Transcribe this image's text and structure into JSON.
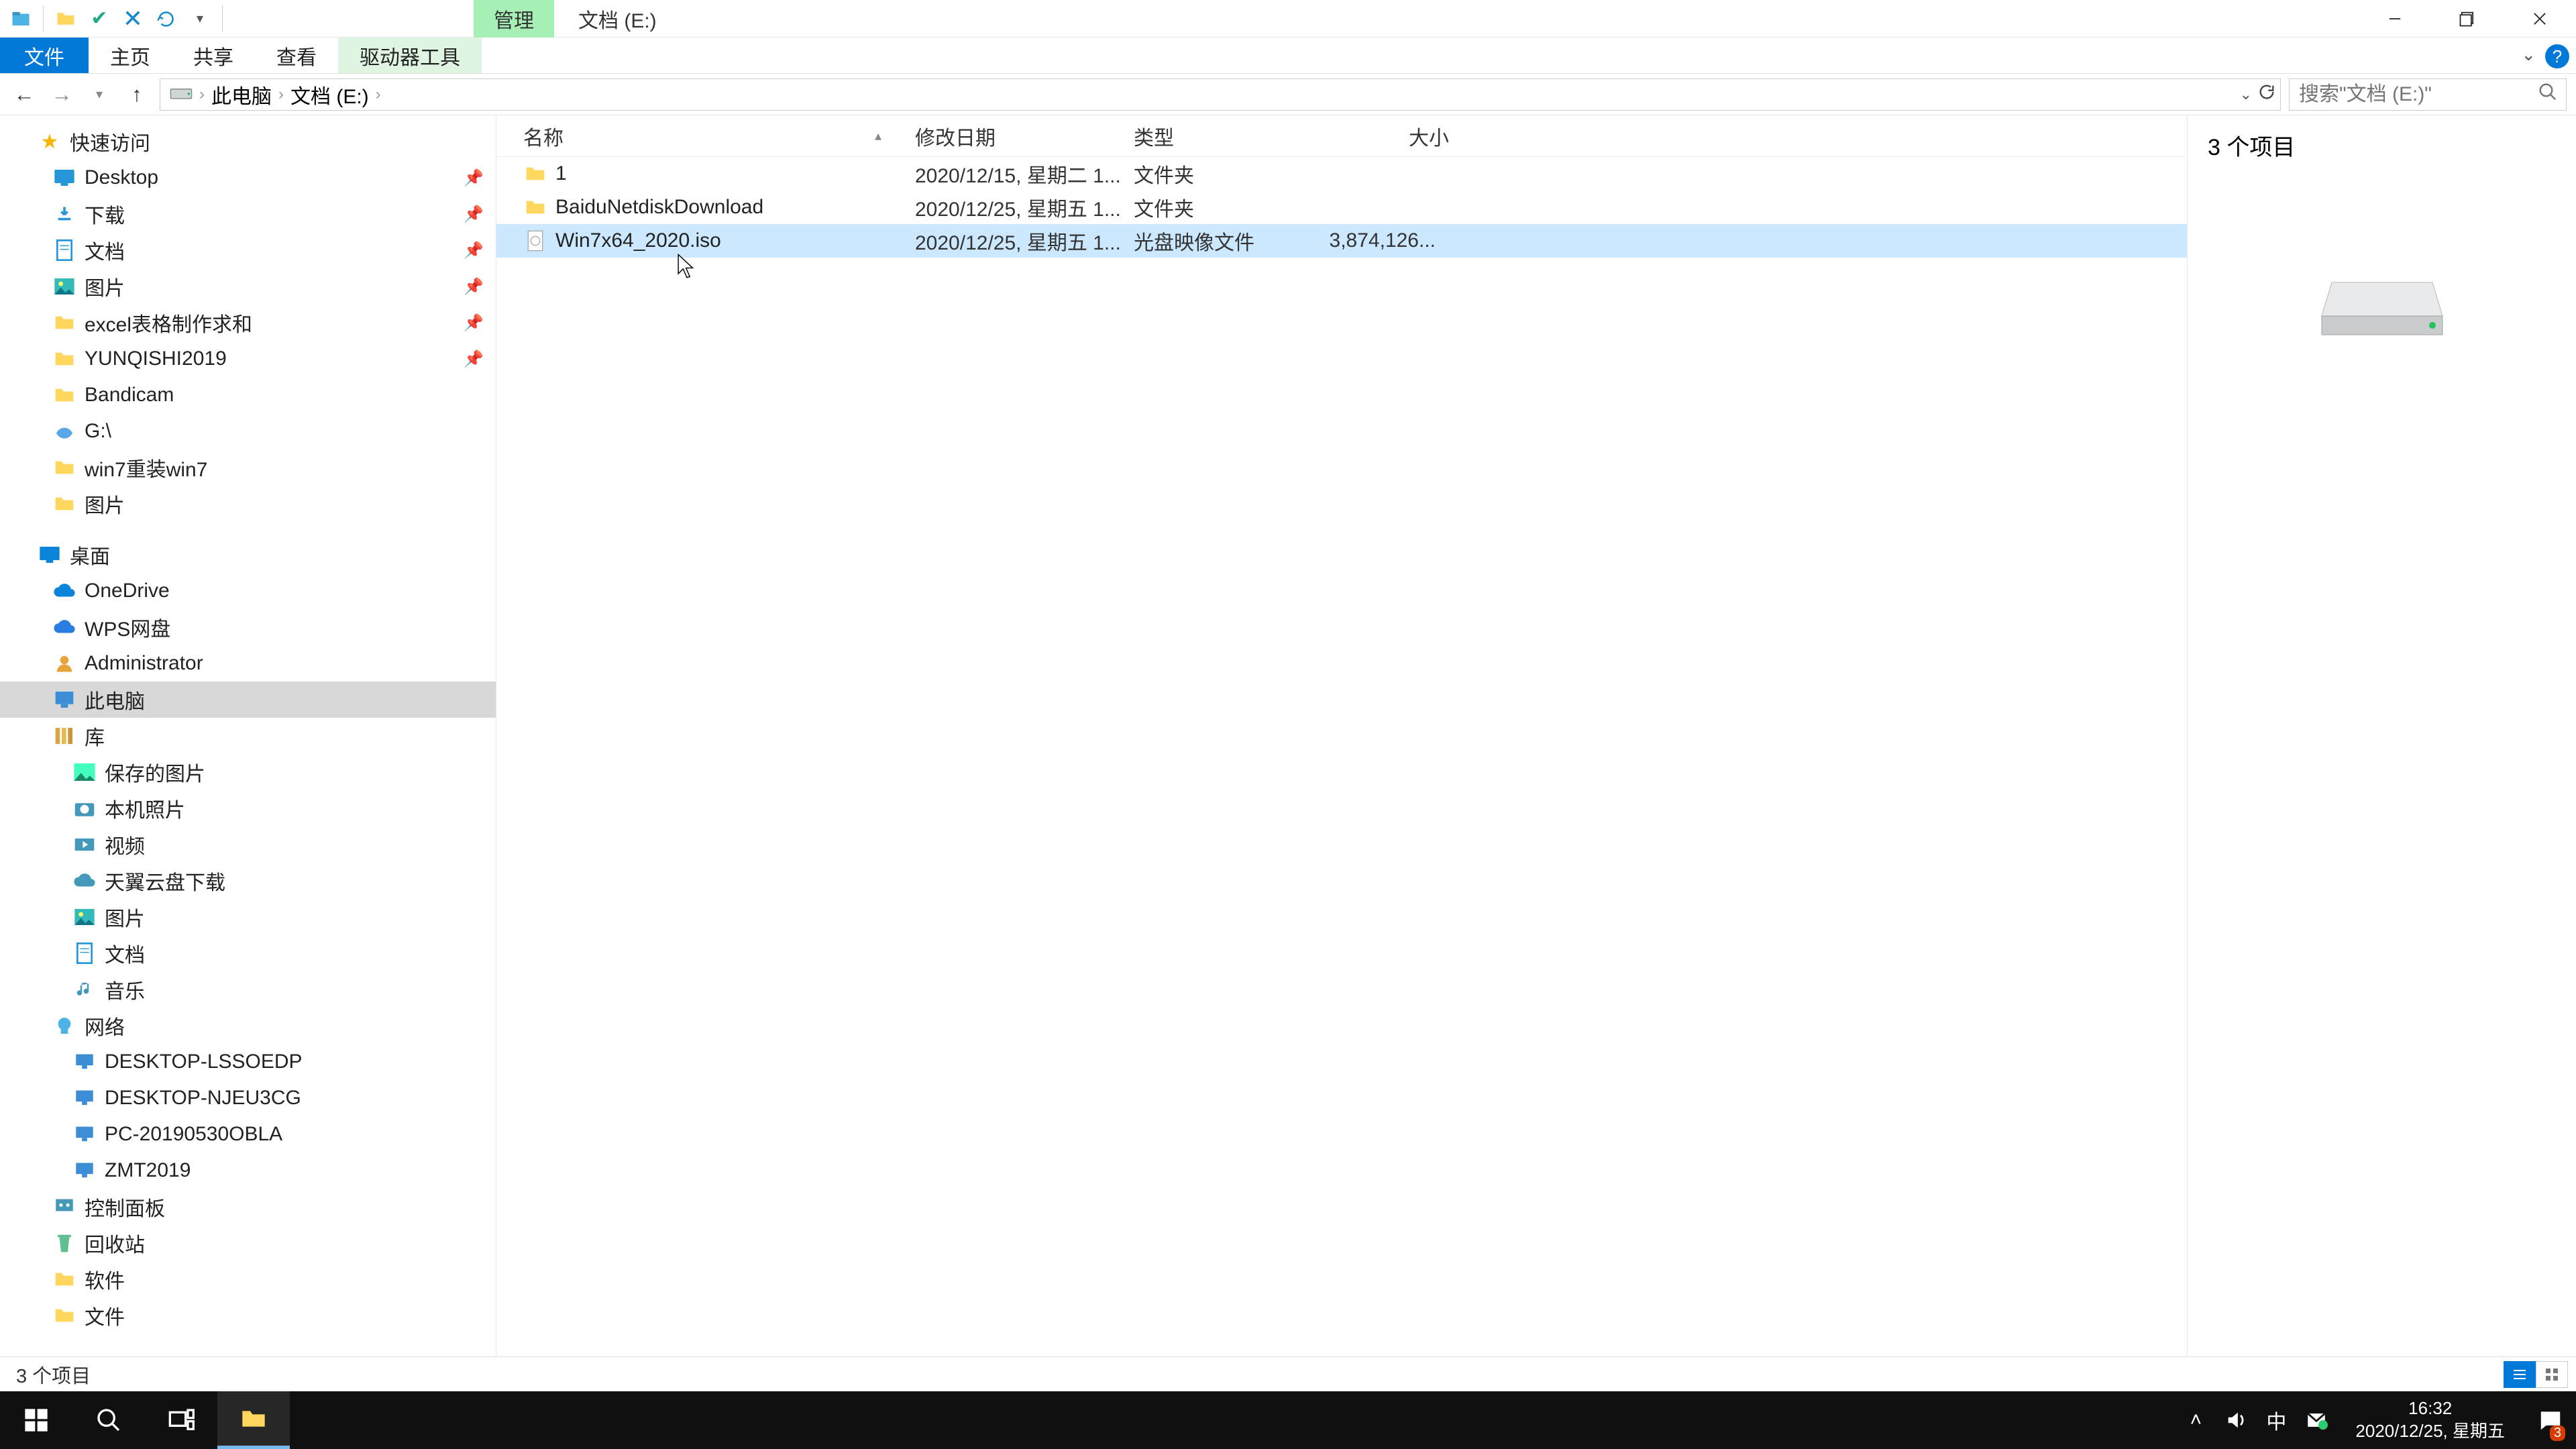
{
  "titlebar": {
    "context_tab": "管理",
    "title": "文档 (E:)"
  },
  "ribbon": {
    "file": "文件",
    "tabs": [
      "主页",
      "共享",
      "查看"
    ],
    "context_tool": "驱动器工具"
  },
  "breadcrumb": {
    "root": "此电脑",
    "segments": [
      "文档 (E:)"
    ]
  },
  "search": {
    "placeholder": "搜索\"文档 (E:)\""
  },
  "nav": {
    "quick_access": "快速访问",
    "quick_items": [
      {
        "label": "Desktop",
        "icon": "desktop"
      },
      {
        "label": "下载",
        "icon": "downloads"
      },
      {
        "label": "文档",
        "icon": "documents"
      },
      {
        "label": "图片",
        "icon": "pictures"
      },
      {
        "label": "excel表格制作求和",
        "icon": "folder"
      },
      {
        "label": "YUNQISHI2019",
        "icon": "folder"
      }
    ],
    "recent_items": [
      {
        "label": "Bandicam",
        "icon": "folder"
      },
      {
        "label": "G:\\",
        "icon": "share"
      },
      {
        "label": "win7重装win7",
        "icon": "folder"
      },
      {
        "label": "图片",
        "icon": "folder"
      }
    ],
    "desktop_header": "桌面",
    "desktop_items": [
      {
        "label": "OneDrive",
        "icon": "onedrive"
      },
      {
        "label": "WPS网盘",
        "icon": "wps"
      },
      {
        "label": "Administrator",
        "icon": "user"
      },
      {
        "label": "此电脑",
        "icon": "pc",
        "selected": true
      },
      {
        "label": "库",
        "icon": "library"
      }
    ],
    "library_items": [
      {
        "label": "保存的图片",
        "icon": "saved-pics"
      },
      {
        "label": "本机照片",
        "icon": "camera"
      },
      {
        "label": "视频",
        "icon": "video"
      },
      {
        "label": "天翼云盘下载",
        "icon": "cloud"
      },
      {
        "label": "图片",
        "icon": "pictures"
      },
      {
        "label": "文档",
        "icon": "documents"
      },
      {
        "label": "音乐",
        "icon": "music"
      }
    ],
    "network_header": "网络",
    "network_items": [
      {
        "label": "DESKTOP-LSSOEDP",
        "icon": "netpc"
      },
      {
        "label": "DESKTOP-NJEU3CG",
        "icon": "netpc"
      },
      {
        "label": "PC-20190530OBLA",
        "icon": "netpc"
      },
      {
        "label": "ZMT2019",
        "icon": "netpc"
      }
    ],
    "tail_items": [
      {
        "label": "控制面板",
        "icon": "control"
      },
      {
        "label": "回收站",
        "icon": "recycle"
      },
      {
        "label": "软件",
        "icon": "folder"
      },
      {
        "label": "文件",
        "icon": "folder"
      }
    ]
  },
  "columns": {
    "name": "名称",
    "date": "修改日期",
    "type": "类型",
    "size": "大小"
  },
  "files": [
    {
      "name": "1",
      "date": "2020/12/15, 星期二 1...",
      "type": "文件夹",
      "size": "",
      "kind": "folder",
      "selected": false
    },
    {
      "name": "BaiduNetdiskDownload",
      "date": "2020/12/25, 星期五 1...",
      "type": "文件夹",
      "size": "",
      "kind": "folder",
      "selected": false
    },
    {
      "name": "Win7x64_2020.iso",
      "date": "2020/12/25, 星期五 1...",
      "type": "光盘映像文件",
      "size": "3,874,126...",
      "kind": "iso",
      "selected": true
    }
  ],
  "details": {
    "count_label": "3 个项目"
  },
  "statusbar": {
    "text": "3 个项目"
  },
  "taskbar": {
    "ime": "中",
    "time": "16:32",
    "date": "2020/12/25, 星期五",
    "notif_count": "3"
  }
}
